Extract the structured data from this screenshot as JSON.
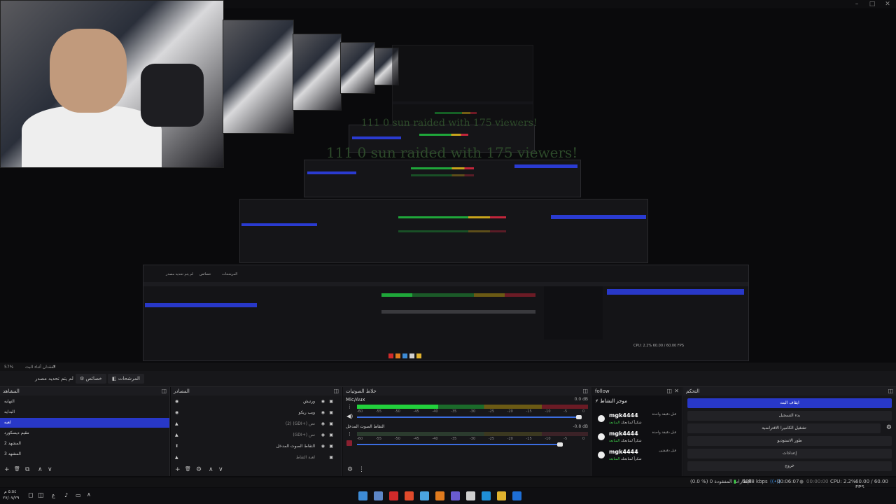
{
  "window": {
    "min_label": "–",
    "max_label": "□",
    "close_label": "✕"
  },
  "preview": {
    "raid_text_1": "111 0 sun raided with 175 viewers!",
    "raid_text_2": "111 0 sun raided with 175 viewers!"
  },
  "midobs": {
    "tab_1": "لم يتم تحديد مصدر",
    "tab_2": "خصائص",
    "tab_3": "المرشحات",
    "docks": [
      "المشاهد",
      "المصادر",
      "خلاط الصوتيات",
      "follow",
      "التحكم"
    ],
    "scenes": [
      "النهايه",
      "البدايه",
      "لعبه",
      "مقيم ديسكورد",
      "المشهد 2",
      "المشهد 3"
    ],
    "chat_title": "موجز النشاط",
    "chat_users": [
      "mgk4444",
      "mgk4444",
      "mgk4444"
    ],
    "controls": [
      "ايقاف البث",
      "بدء التسجيل",
      "تشغيل الكاميرا الافتراضية",
      "طور الاستوديو",
      "إعدادات",
      "خروج"
    ],
    "status": "CPU: 2.2%  60.00 / 60.00 FPS"
  },
  "statusstrip": {
    "left": "57%",
    "mid": "الفقدان أثناء البث",
    "scale_label": "▾"
  },
  "toolbar": {
    "no_source": "لم يتم تحديد مصدر",
    "properties": "خصائص",
    "filters": "المرشحات"
  },
  "scenes_dock": {
    "title": "المشاهد",
    "items": [
      {
        "label": "النهايه",
        "selected": false
      },
      {
        "label": "البدايه",
        "selected": false
      },
      {
        "label": "لعبه",
        "selected": true
      },
      {
        "label": "مقيم ديسكورد",
        "selected": false
      },
      {
        "label": "المشهد 2",
        "selected": false
      },
      {
        "label": "المشهد 3",
        "selected": false
      }
    ],
    "footer": {
      "add": "+",
      "remove": "🗑",
      "filter": "⧉",
      "up": "∧",
      "down": "∨"
    }
  },
  "sources_dock": {
    "title": "المصادر",
    "items": [
      {
        "label": "ورتيش",
        "icon": "◉"
      },
      {
        "label": "ويب ريكو",
        "icon": "◉"
      },
      {
        "label": "(2) (GDI+) نص",
        "icon": "▲"
      },
      {
        "label": "(GDI+) نص",
        "icon": "▲"
      },
      {
        "label": "التقاط الصوت المدخل",
        "icon": "⬆"
      },
      {
        "label": "لعبة التقاط",
        "icon": "▲"
      }
    ],
    "footer": {
      "add": "+",
      "remove": "🗑",
      "settings": "⚙",
      "up": "∧",
      "down": "∨"
    }
  },
  "mixer_dock": {
    "title": "خلاط الصوتيات",
    "channels": [
      {
        "name": "Mic/Aux",
        "db": "0.0 dB",
        "level": 0.35,
        "volume": 0.96
      },
      {
        "name": "التقاط الصوت المدخل",
        "db": "-0.8 dB",
        "level": 0.0,
        "volume": 0.88
      }
    ],
    "ticks": [
      "-60",
      "-55",
      "-50",
      "-45",
      "-40",
      "-35",
      "-30",
      "-25",
      "-20",
      "-15",
      "-10",
      "-5",
      "0"
    ],
    "footer": {
      "gear": "⚙",
      "menu": "⋮"
    }
  },
  "chat_dock": {
    "title": "follow",
    "header": "موجز النشاط",
    "messages": [
      {
        "user": "mgk4444",
        "time": "قبل دقيقة واحدة",
        "text_prefix": "شكراً لمتابعتك",
        "text_highlight": "المتابعة"
      },
      {
        "user": "mgk4444",
        "time": "قبل دقيقة واحدة",
        "text_prefix": "شكراً لمتابعتك",
        "text_highlight": "المتابعة"
      },
      {
        "user": "mgk4444",
        "time": "قبل دقيقتين",
        "text_prefix": "شكراً لمتابعتك",
        "text_highlight": "المتابعة"
      }
    ]
  },
  "controls_dock": {
    "title": "التحكم",
    "buttons": [
      {
        "label": "ايقاف البث",
        "primary": true
      },
      {
        "label": "بدء التسجيل",
        "primary": false
      },
      {
        "label": "تشغيل الكاميرا الافتراضية",
        "primary": false
      },
      {
        "label": "طور الاستوديو",
        "primary": false
      },
      {
        "label": "إعدادات",
        "primary": false
      },
      {
        "label": "خروج",
        "primary": false
      }
    ],
    "gear": "⚙"
  },
  "statusbar": {
    "dropped": "(0.0 %) 0 الإطارات المفقودة",
    "bitrate": "6688 kbps",
    "stream_time": "00:06:07",
    "rec_time": "00:00:00",
    "cpu": "CPU: 2.2%",
    "fps": "60.00 / 60.00 FPS"
  },
  "taskbar": {
    "time": "٥:٥٤ م",
    "date": "٢٧/٠٧/٢٩",
    "lang": "ع",
    "icon_colors": [
      "#3d8bd6",
      "#5c86c7",
      "#d12a2a",
      "#e04a2b",
      "#4aa3df",
      "#e07b1e",
      "#6a5bd1",
      "#cfcfcf",
      "#1f8fd6",
      "#e0b22e",
      "#1e6fd6"
    ]
  }
}
